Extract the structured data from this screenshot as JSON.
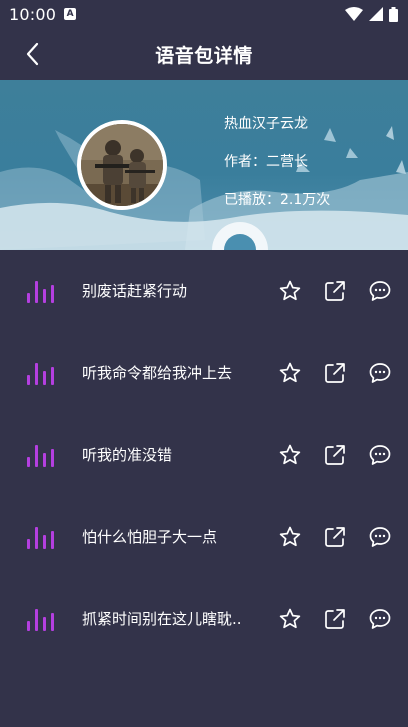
{
  "status_bar": {
    "time": "10:00",
    "notification_letter": "A"
  },
  "app_bar": {
    "title": "语音包详情",
    "back_icon": "chevron-left-icon"
  },
  "pack": {
    "name": "热血汉子云龙",
    "author": "作者：二营长",
    "plays": "已播放：2.1万次"
  },
  "colors": {
    "background": "#33334a",
    "accent": "#b43fe0",
    "header": "#3e7f9a"
  },
  "tracks": [
    {
      "title": "别废话赶紧行动"
    },
    {
      "title": "听我命令都给我冲上去"
    },
    {
      "title": "听我的准没错"
    },
    {
      "title": "怕什么怕胆子大一点"
    },
    {
      "title": "抓紧时间别在这儿瞎耽.."
    }
  ],
  "track_icons": {
    "wave": "sound-wave-icon",
    "favorite": "star-icon",
    "share": "share-icon",
    "comment": "comment-icon"
  }
}
